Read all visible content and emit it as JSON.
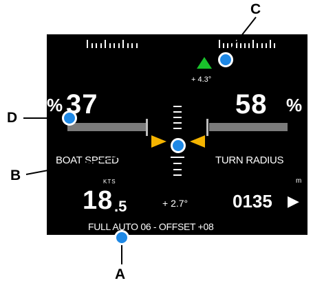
{
  "display": {
    "left_percent_sign": "%",
    "left_percent_value": "37",
    "right_percent_value": "58",
    "right_percent_sign": "%",
    "left_label": "BOAT SPEED",
    "right_label": "TURN RADIUS",
    "speed_value": "18",
    "speed_decimal": ".5",
    "speed_unit": "KTS",
    "center_angle": "+ 2.7°",
    "turn_radius_value": "0135",
    "turn_radius_unit": "m",
    "turn_arrow": "▶",
    "top_angle": "+ 4.3°",
    "mode_line": "FULL AUTO 06 - OFFSET +08",
    "left_bar_level": 0.37,
    "right_bar_level": 0.58
  },
  "callouts": [
    {
      "letter": "A"
    },
    {
      "letter": "B"
    },
    {
      "letter": "C"
    },
    {
      "letter": "D"
    }
  ],
  "colors": {
    "background": "#000000",
    "text": "#ffffff",
    "bar": "#7b7b7b",
    "arrow_up": "#19c22b",
    "chevron": "#f5b400",
    "callout_dot": "#1e88e5"
  }
}
